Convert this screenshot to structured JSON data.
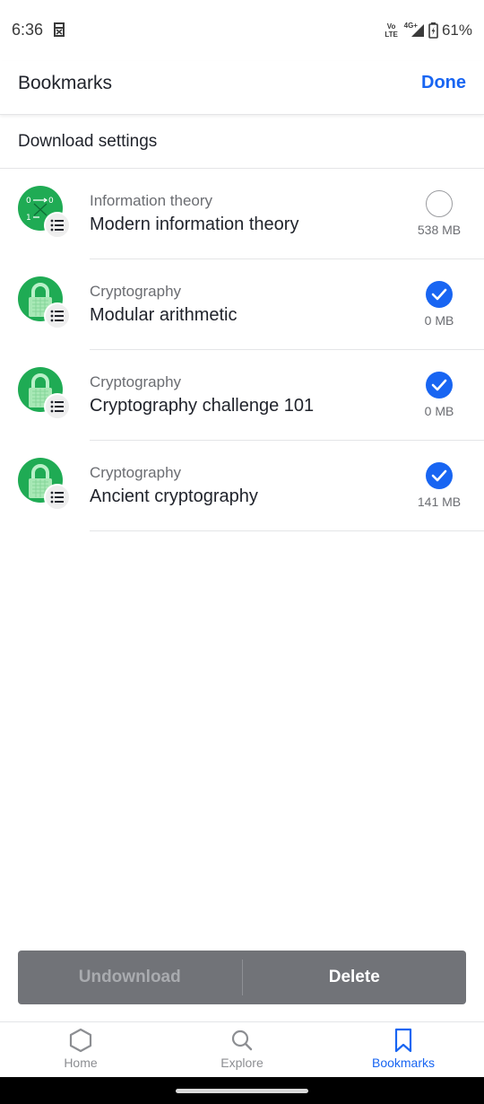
{
  "status_bar": {
    "time": "6:36",
    "volte_line1": "Vo",
    "volte_line2": "LTE",
    "network": "4G+",
    "battery": "61%"
  },
  "header": {
    "title": "Bookmarks",
    "done_label": "Done"
  },
  "download_settings_label": "Download settings",
  "items": [
    {
      "category": "Information theory",
      "title": "Modern information theory",
      "size": "538 MB",
      "checked": false,
      "icon": "binary-icon"
    },
    {
      "category": "Cryptography",
      "title": "Modular arithmetic",
      "size": "0 MB",
      "checked": true,
      "icon": "lock-icon"
    },
    {
      "category": "Cryptography",
      "title": "Cryptography challenge 101",
      "size": "0 MB",
      "checked": true,
      "icon": "lock-icon"
    },
    {
      "category": "Cryptography",
      "title": "Ancient cryptography",
      "size": "141 MB",
      "checked": true,
      "icon": "lock-icon"
    }
  ],
  "actions": {
    "undownload_label": "Undownload",
    "delete_label": "Delete"
  },
  "nav": {
    "home_label": "Home",
    "explore_label": "Explore",
    "bookmarks_label": "Bookmarks",
    "active": "bookmarks"
  },
  "colors": {
    "accent": "#1865f2",
    "thumb_green": "#1fab54",
    "action_bar": "#717378"
  }
}
